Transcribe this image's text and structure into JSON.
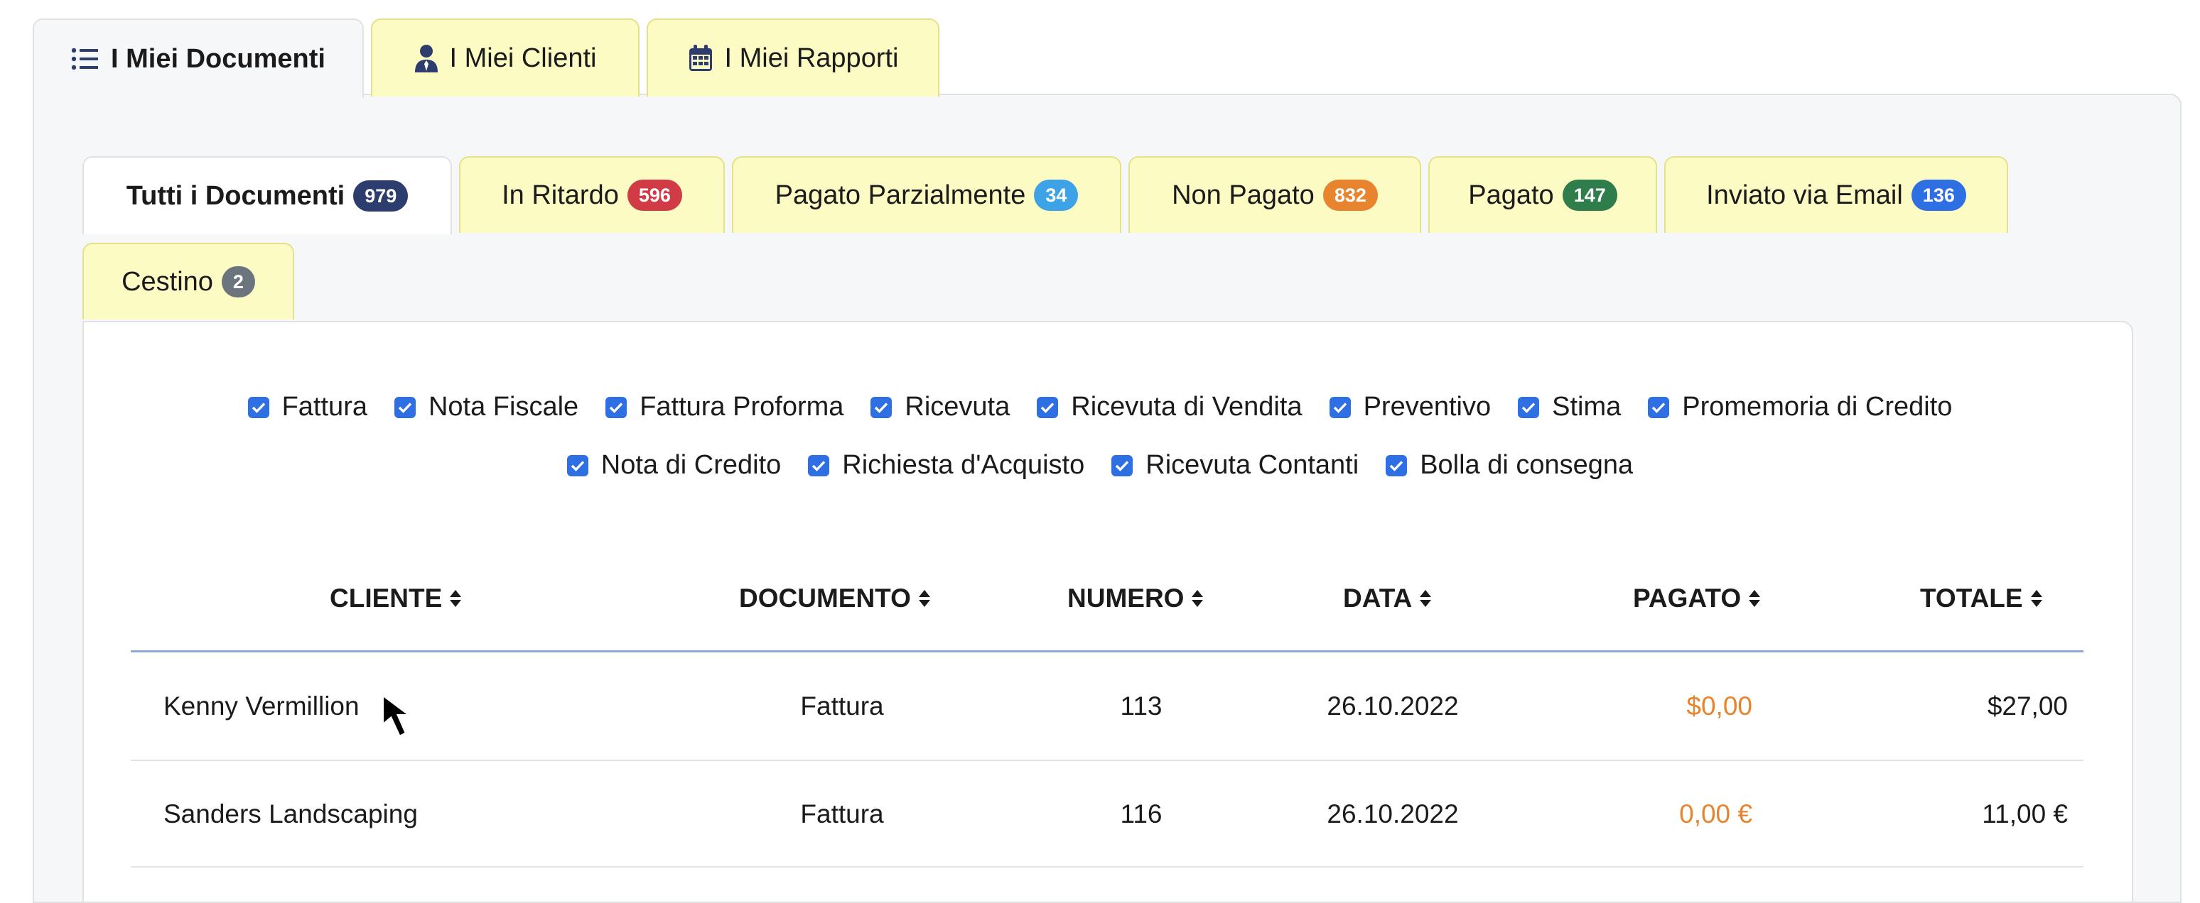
{
  "top_tabs": [
    {
      "label": "I Miei Documenti",
      "icon": "list-icon",
      "active": true
    },
    {
      "label": "I Miei Clienti",
      "icon": "user-tie-icon",
      "active": false
    },
    {
      "label": "I Miei Rapporti",
      "icon": "calendar-icon",
      "active": false
    }
  ],
  "sub_tabs": [
    {
      "label": "Tutti i Documenti",
      "count": "979",
      "badge_color": "#2c3d6e",
      "active": true
    },
    {
      "label": "In Ritardo",
      "count": "596",
      "badge_color": "#d13b45"
    },
    {
      "label": "Pagato Parzialmente",
      "count": "34",
      "badge_color": "#3ea3e6"
    },
    {
      "label": "Non Pagato",
      "count": "832",
      "badge_color": "#e8832e"
    },
    {
      "label": "Pagato",
      "count": "147",
      "badge_color": "#2e7d4a"
    },
    {
      "label": "Inviato via Email",
      "count": "136",
      "badge_color": "#2f6fe4"
    },
    {
      "label": "Cestino",
      "count": "2",
      "badge_color": "#6c757d"
    }
  ],
  "filters": [
    {
      "label": "Fattura",
      "checked": true
    },
    {
      "label": "Nota Fiscale",
      "checked": true
    },
    {
      "label": "Fattura Proforma",
      "checked": true
    },
    {
      "label": "Ricevuta",
      "checked": true
    },
    {
      "label": "Ricevuta di Vendita",
      "checked": true
    },
    {
      "label": "Preventivo",
      "checked": true
    },
    {
      "label": "Stima",
      "checked": true
    },
    {
      "label": "Promemoria di Credito",
      "checked": true
    },
    {
      "label": "Nota di Credito",
      "checked": true
    },
    {
      "label": "Richiesta d'Acquisto",
      "checked": true
    },
    {
      "label": "Ricevuta Contanti",
      "checked": true
    },
    {
      "label": "Bolla di consegna",
      "checked": true
    }
  ],
  "table": {
    "columns": [
      "CLIENTE",
      "DOCUMENTO",
      "NUMERO",
      "DATA",
      "PAGATO",
      "TOTALE"
    ],
    "rows": [
      {
        "cliente": "Kenny Vermillion",
        "documento": "Fattura",
        "numero": "113",
        "data": "26.10.2022",
        "pagato": "$0,00",
        "totale": "$27,00"
      },
      {
        "cliente": "Sanders Landscaping",
        "documento": "Fattura",
        "numero": "116",
        "data": "26.10.2022",
        "pagato": "0,00 €",
        "totale": "11,00 €"
      }
    ]
  },
  "colors": {
    "accent": "#2f6fe4",
    "tab_bg": "#fdfbc4",
    "pagato": "#e8832e"
  }
}
